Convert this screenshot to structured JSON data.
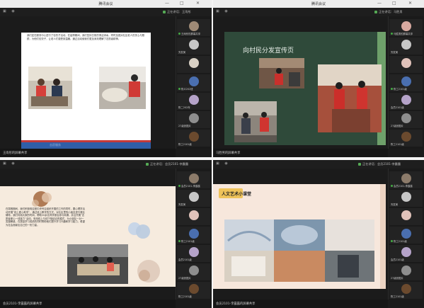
{
  "windows": [
    {
      "title": "腾讯会议",
      "speaking": "正在讲话：王雨彤",
      "footer": "王雨彤的屏幕共享",
      "slide": {
        "paragraph": "我们还在服务中心进行了包饺子活动。在疫情期间，我们坚持日常的清洁消毒，同时加强对社区老人的关心与照顾，为他们包饺子，让老人们感受到温暖。通过活动使我们更加深刻理解了志愿者精神。",
        "watermark": "志愿服务"
      },
      "participants": [
        "王雨彤的屏幕共享",
        "完发美",
        "",
        "陈义202班",
        "陈二202年",
        "27级张图片",
        "陈工2101级"
      ]
    },
    {
      "title": "腾讯会议",
      "speaking": "正在讲话：马胜男",
      "footer": "马胜男的屏幕共享",
      "slide": {
        "heading": "向村民分发宣传页"
      },
      "participants": [
        "马胜男的屏幕共享",
        "完发美",
        "",
        "陈工2101级",
        "会员2101级",
        "27级张图片",
        "陈工2101级"
      ]
    },
    {
      "title": "",
      "speaking": "正在讲话：会员2101-李露露",
      "footer": "会员2101-李露露的屏幕共享",
      "slide": {
        "paragraph": "在寒假期间，我们积极响应团中央号召组织开展的工作的同时，要心理学活动开展“线上爱心助学”，通过线上教学的方式，对社区里的小朋友进行课业辅导。我们利用大家的时间，帮助50余名同学报名参与网课，并且开展“志愿者爱心一线接力”活动，采用线上与线下相结合的模式，为小朋友一对一答疑解惑，在提高学习成绩的同时帮助他们提升学习兴趣和学习能力，希望为社会贡献出自己的一份力量。"
      },
      "participants": [
        "会员2101-李露露",
        "完发美",
        "",
        "陈工2101级",
        "会员2101级",
        "27级张图片",
        "陈工2101级"
      ]
    },
    {
      "title": "",
      "speaking": "正在讲话：会员2101-李露露",
      "footer": "会员2101-李露露的屏幕共享",
      "slide": {
        "heading": "人文艺术小课堂"
      },
      "participants": [
        "会员2101-李露露",
        "完发美",
        "",
        "陈工2101级",
        "会员2101级",
        "27级张图片",
        "陈工2101级"
      ]
    }
  ],
  "colors": {
    "win_bg": "#1b1b1b",
    "green_slide": "#2f4a3a",
    "cream_slide": "#f6ebde",
    "peach_slide": "#f7e7dc",
    "accent_red": "#c43a3a",
    "accent_brown": "#b07b55",
    "accent_blue": "#2f5ea8"
  },
  "icons": [
    "minimize-icon",
    "maximize-icon",
    "close-icon",
    "mic-icon",
    "camera-icon"
  ]
}
